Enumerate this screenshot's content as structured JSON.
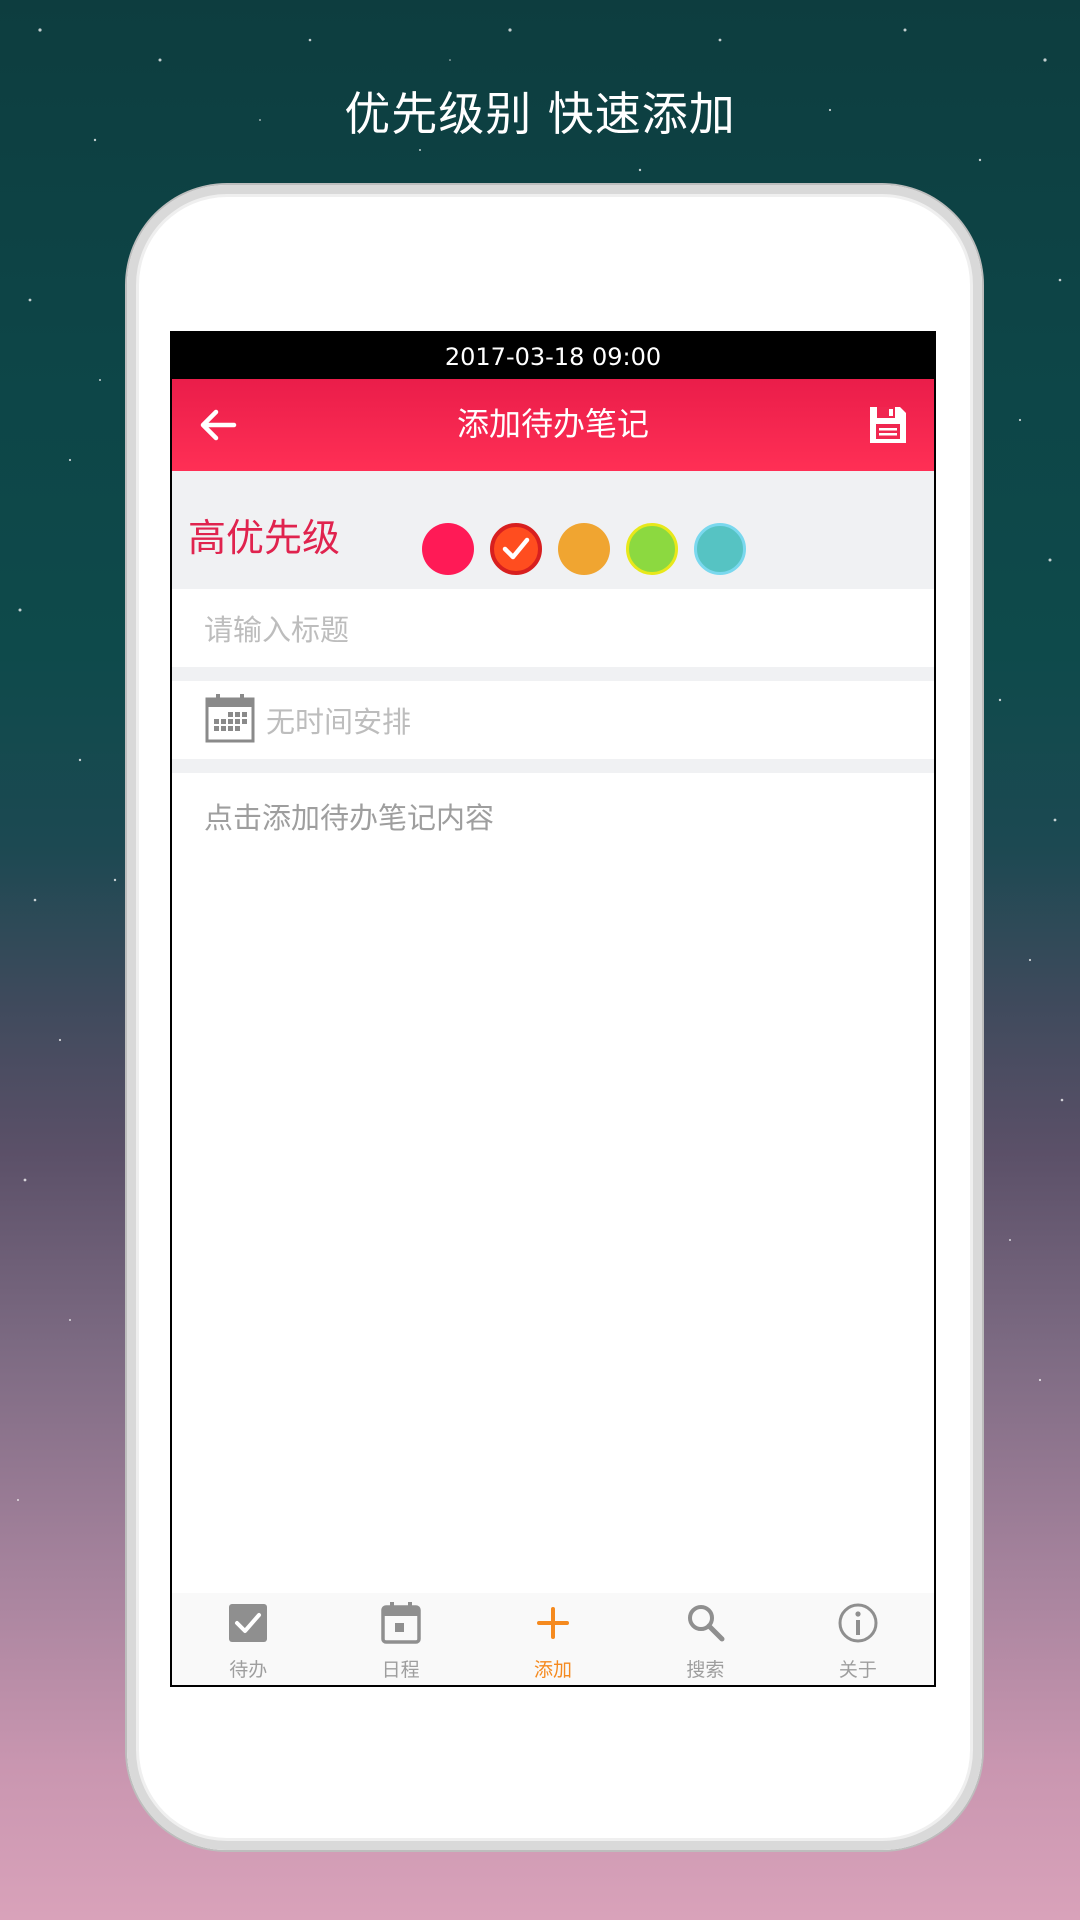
{
  "headline": "优先级别 快速添加",
  "status_bar": {
    "datetime": "2017-03-18 09:00"
  },
  "app_bar": {
    "title": "添加待办笔记",
    "back_icon": "arrow-left-icon",
    "save_icon": "floppy-disk-icon"
  },
  "priority": {
    "label": "高优先级",
    "options": [
      {
        "name": "pink",
        "color": "#ff1a56",
        "selected": false
      },
      {
        "name": "red-orange",
        "color": "#ff4d1f",
        "selected": true
      },
      {
        "name": "orange",
        "color": "#f0a531",
        "selected": false
      },
      {
        "name": "green",
        "color": "#8cd940",
        "selected": false
      },
      {
        "name": "teal",
        "color": "#56c3c3",
        "selected": false
      }
    ]
  },
  "form": {
    "title_placeholder": "请输入标题",
    "time_placeholder": "无时间安排",
    "content_placeholder": "点击添加待办笔记内容"
  },
  "bottom_nav": [
    {
      "label": "待办",
      "icon": "checkbox-icon",
      "active": false
    },
    {
      "label": "日程",
      "icon": "calendar-icon",
      "active": false
    },
    {
      "label": "添加",
      "icon": "plus-icon",
      "active": true
    },
    {
      "label": "搜索",
      "icon": "search-icon",
      "active": false
    },
    {
      "label": "关于",
      "icon": "info-icon",
      "active": false
    }
  ],
  "colors": {
    "accent": "#ff2f55",
    "priority_text": "#e0234e",
    "active_nav": "#f58a1f",
    "inactive_nav": "#9e9e9e"
  }
}
